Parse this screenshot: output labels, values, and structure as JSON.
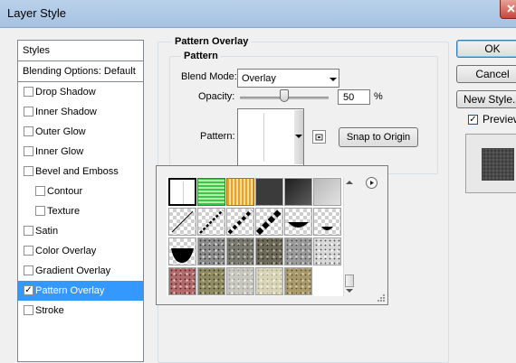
{
  "window": {
    "title": "Layer Style"
  },
  "styles_panel": {
    "header": "Styles",
    "blending_options": "Blending Options: Default",
    "items": [
      {
        "label": "Drop Shadow",
        "checked": false,
        "indent": false,
        "selected": false
      },
      {
        "label": "Inner Shadow",
        "checked": false,
        "indent": false,
        "selected": false
      },
      {
        "label": "Outer Glow",
        "checked": false,
        "indent": false,
        "selected": false
      },
      {
        "label": "Inner Glow",
        "checked": false,
        "indent": false,
        "selected": false
      },
      {
        "label": "Bevel and Emboss",
        "checked": false,
        "indent": false,
        "selected": false
      },
      {
        "label": "Contour",
        "checked": false,
        "indent": true,
        "selected": false
      },
      {
        "label": "Texture",
        "checked": false,
        "indent": true,
        "selected": false
      },
      {
        "label": "Satin",
        "checked": false,
        "indent": false,
        "selected": false
      },
      {
        "label": "Color Overlay",
        "checked": false,
        "indent": false,
        "selected": false
      },
      {
        "label": "Gradient Overlay",
        "checked": false,
        "indent": false,
        "selected": false
      },
      {
        "label": "Pattern Overlay",
        "checked": true,
        "indent": false,
        "selected": true
      },
      {
        "label": "Stroke",
        "checked": false,
        "indent": false,
        "selected": false
      }
    ],
    "check_mark": "✓"
  },
  "buttons": {
    "ok": "OK",
    "cancel": "Cancel",
    "new_style": "New Style...",
    "preview_label": "Preview",
    "preview_checked": true
  },
  "pattern_overlay": {
    "group_title": "Pattern Overlay",
    "subgroup_title": "Pattern",
    "blend_mode_label": "Blend Mode:",
    "blend_mode_value": "Overlay",
    "opacity_label": "Opacity:",
    "opacity_value": "50",
    "opacity_unit": "%",
    "opacity_level": 0.5,
    "pattern_label": "Pattern:",
    "snap_button": "Snap to Origin"
  },
  "pattern_picker": {
    "swatches": [
      {
        "kind": "white-paper",
        "selected": true
      },
      {
        "kind": "green-maze"
      },
      {
        "kind": "orange-maze"
      },
      {
        "kind": "dark-gray"
      },
      {
        "kind": "dark-gradient"
      },
      {
        "kind": "light-gray"
      },
      {
        "kind": "checker-diag-thin"
      },
      {
        "kind": "checker-diag-medium"
      },
      {
        "kind": "checker-diag-dash"
      },
      {
        "kind": "checker-diag-bold"
      },
      {
        "kind": "checker-semicircle-black"
      },
      {
        "kind": "checker-semicircle-small"
      },
      {
        "kind": "black-bowl"
      },
      {
        "kind": "granite-gray"
      },
      {
        "kind": "rock-gray"
      },
      {
        "kind": "pebbles"
      },
      {
        "kind": "stone-gray"
      },
      {
        "kind": "speckled-white"
      },
      {
        "kind": "red-granite"
      },
      {
        "kind": "olive-rock"
      },
      {
        "kind": "pale-stone"
      },
      {
        "kind": "cream-stone"
      },
      {
        "kind": "tan-stone"
      }
    ]
  },
  "colors": {
    "selection": "#3399ff",
    "titlebar": "#b9d1ea"
  }
}
